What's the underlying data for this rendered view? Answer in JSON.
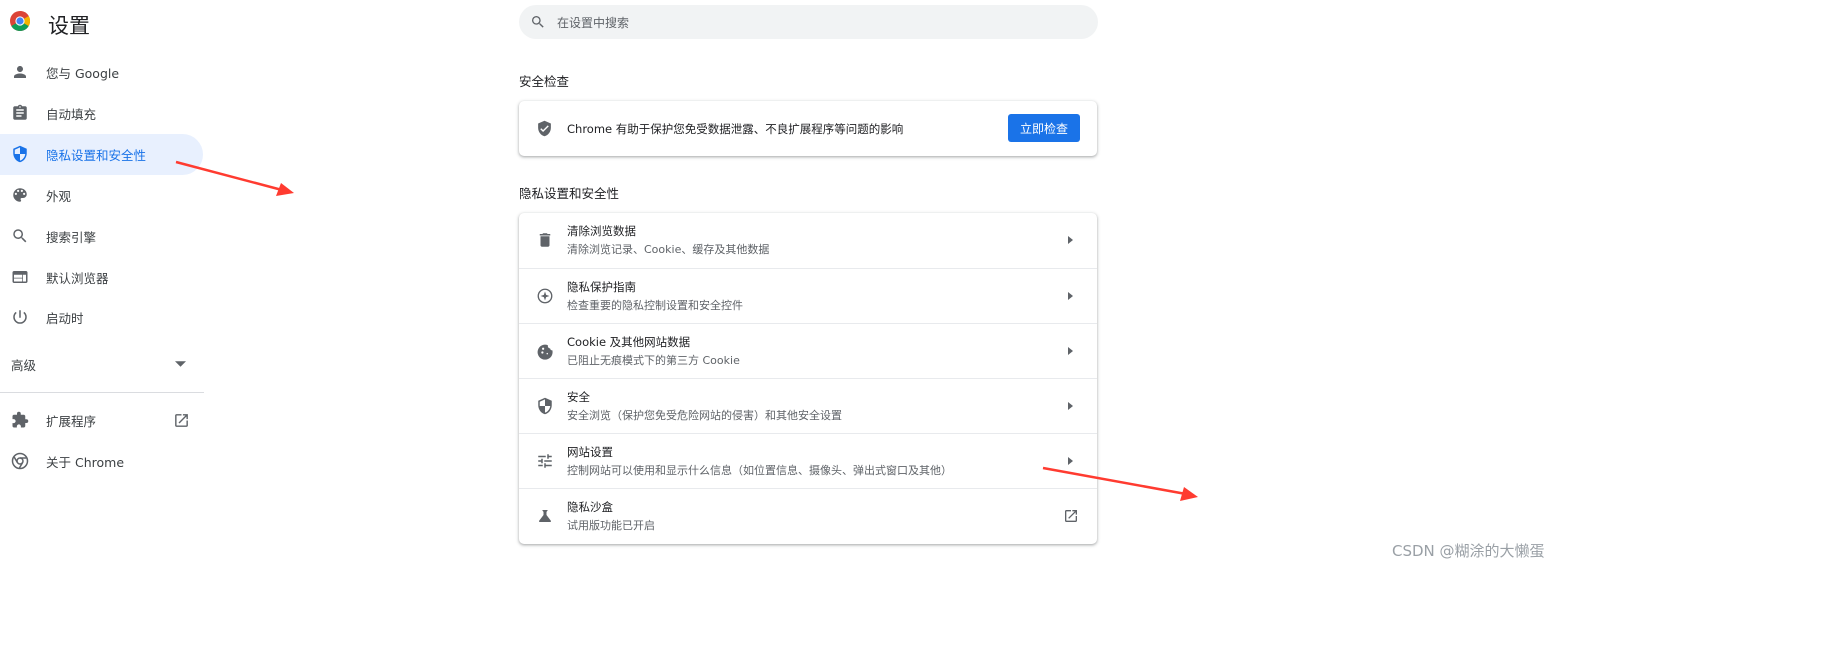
{
  "app": {
    "title": "设置"
  },
  "search": {
    "placeholder": "在设置中搜索"
  },
  "sidebar": {
    "items": [
      {
        "label": "您与 Google",
        "icon": "person-icon"
      },
      {
        "label": "自动填充",
        "icon": "clipboard-icon"
      },
      {
        "label": "隐私设置和安全性",
        "icon": "shield-icon",
        "active": true
      },
      {
        "label": "外观",
        "icon": "palette-icon"
      },
      {
        "label": "搜索引擎",
        "icon": "search-icon"
      },
      {
        "label": "默认浏览器",
        "icon": "browser-icon"
      },
      {
        "label": "启动时",
        "icon": "power-icon"
      }
    ],
    "advanced_label": "高级",
    "extensions_label": "扩展程序",
    "about_label": "关于 Chrome"
  },
  "safety_check": {
    "heading": "安全检查",
    "text": "Chrome 有助于保护您免受数据泄露、不良扩展程序等问题的影响",
    "button_label": "立即检查"
  },
  "privacy": {
    "heading": "隐私设置和安全性",
    "rows": [
      {
        "title": "清除浏览数据",
        "subtitle": "清除浏览记录、Cookie、缓存及其他数据",
        "icon": "trash-icon"
      },
      {
        "title": "隐私保护指南",
        "subtitle": "检查重要的隐私控制设置和安全控件",
        "icon": "compass-icon"
      },
      {
        "title": "Cookie 及其他网站数据",
        "subtitle": "已阻止无痕模式下的第三方 Cookie",
        "icon": "cookie-icon"
      },
      {
        "title": "安全",
        "subtitle": "安全浏览（保护您免受危险网站的侵害）和其他安全设置",
        "icon": "security-shield-icon"
      },
      {
        "title": "网站设置",
        "subtitle": "控制网站可以使用和显示什么信息（如位置信息、摄像头、弹出式窗口及其他）",
        "icon": "tune-icon"
      },
      {
        "title": "隐私沙盒",
        "subtitle": "试用版功能已开启",
        "icon": "flask-icon"
      }
    ]
  },
  "watermark": "CSDN @糊涂的大懒蛋",
  "colors": {
    "accent": "#1a73e8",
    "active_bg": "#e8f0fe",
    "annotation_arrow": "#ff3b30"
  }
}
